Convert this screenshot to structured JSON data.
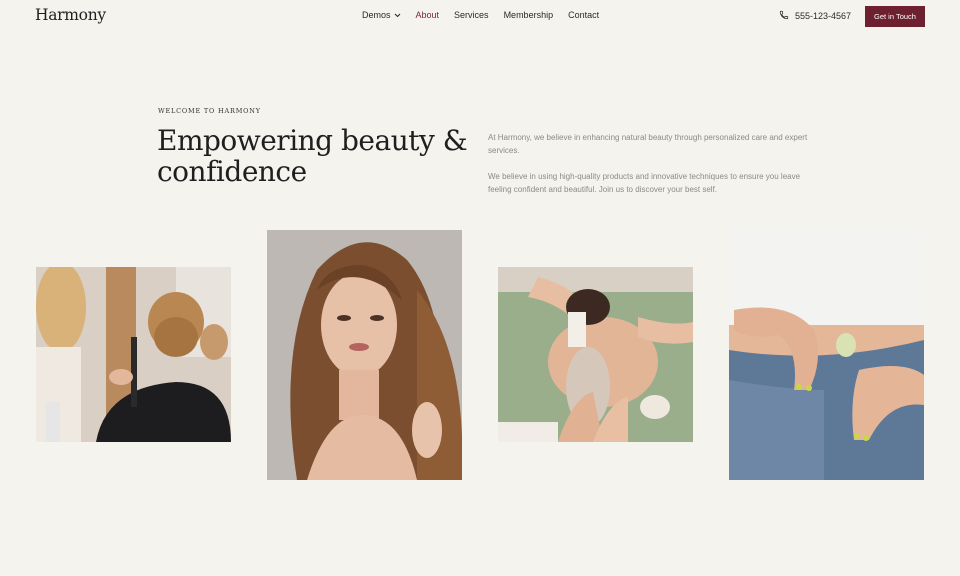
{
  "brand": {
    "name": "Harmony"
  },
  "nav": {
    "items": [
      {
        "label": "Demos",
        "has_dropdown": true,
        "active": false
      },
      {
        "label": "About",
        "active": true
      },
      {
        "label": "Services",
        "active": false
      },
      {
        "label": "Membership",
        "active": false
      },
      {
        "label": "Contact",
        "active": false
      }
    ],
    "phone": "555-123-4567",
    "cta_label": "Get in Touch"
  },
  "hero": {
    "eyebrow": "WELCOME TO HARMONY",
    "headline_line1": "Empowering beauty &",
    "headline_line2": "confidence",
    "paragraph1": "At Harmony, we believe in enhancing natural beauty through personalized care and expert services.",
    "paragraph2": "We believe in using high-quality products and innovative techniques to ensure you leave feeling confident and beautiful. Join us to discover your best self."
  },
  "gallery": [
    {
      "subject": "hair-styling"
    },
    {
      "subject": "portrait"
    },
    {
      "subject": "spa-treatment"
    },
    {
      "subject": "nail-care"
    }
  ],
  "colors": {
    "background": "#f5f3ee",
    "accent": "#6d2030",
    "nav_active": "#7a2a36",
    "body_text": "#8c8a86"
  }
}
